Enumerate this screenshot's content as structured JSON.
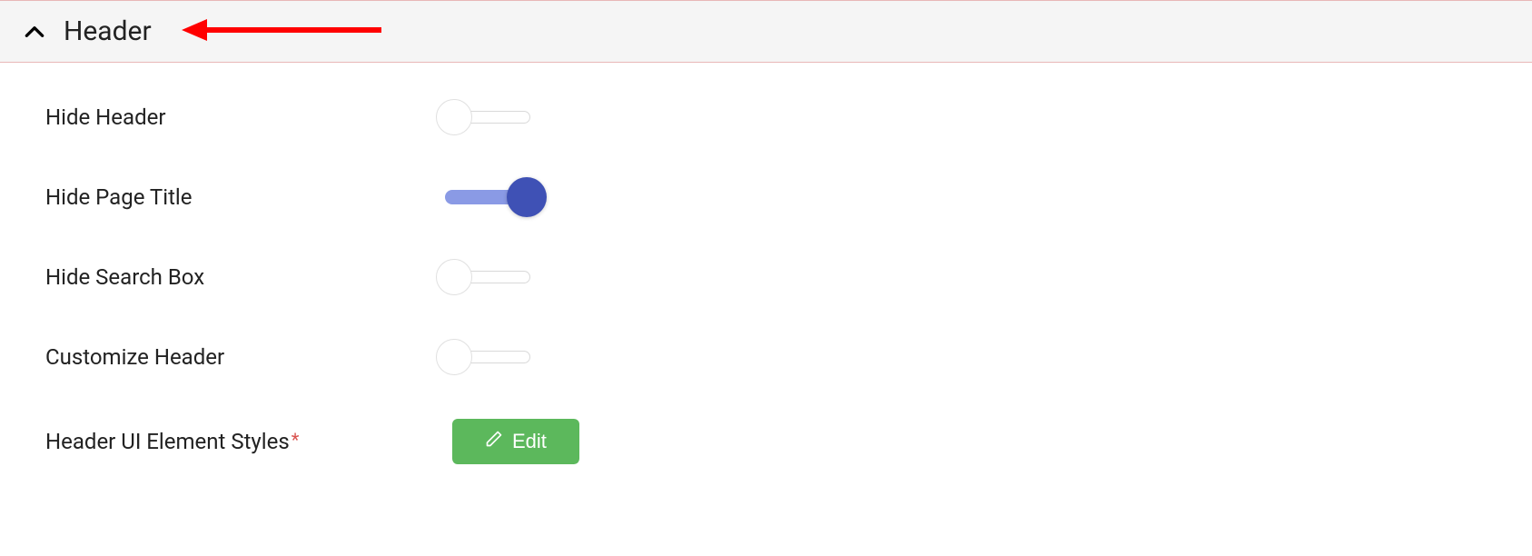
{
  "section": {
    "title": "Header"
  },
  "settings": {
    "hide_header": {
      "label": "Hide Header",
      "on": false
    },
    "hide_page_title": {
      "label": "Hide Page Title",
      "on": true
    },
    "hide_search_box": {
      "label": "Hide Search Box",
      "on": false
    },
    "customize_header": {
      "label": "Customize Header",
      "on": false
    },
    "header_ui_styles": {
      "label": "Header UI Element Styles",
      "required": true,
      "button_label": "Edit"
    }
  },
  "annotation": {
    "type": "arrow",
    "color": "#ff0000"
  }
}
